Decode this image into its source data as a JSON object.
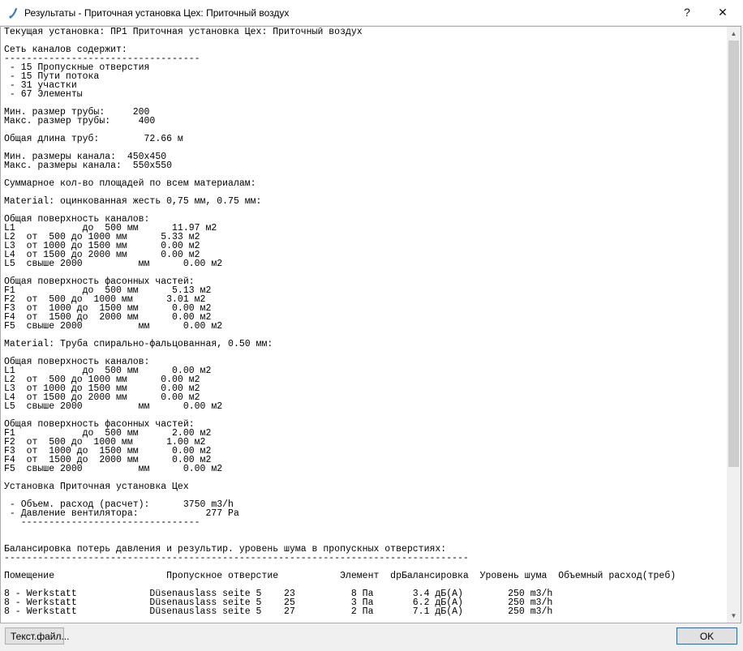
{
  "window": {
    "title": "Результаты - Приточная установка Цех: Приточный воздух",
    "help_label": "?",
    "close_label": "✕"
  },
  "report": {
    "text": "Текущая установка: ПР1 Приточная установка Цех: Приточный воздух\n\nСеть каналов содержит:\n-----------------------------------\n - 15 Пропускные отверстия\n - 15 Пути потока\n - 31 участки\n - 67 Элементы\n\nМин. размер трубы:     200\nМакс. размер трубы:     400\n\nОбщая длина труб:        72.66 м\n\nМин. размеры канала:  450x450\nМакс. размеры канала:  550x550\n\nСуммарное кол-во площадей по всем материалам:\n\nMaterial: оцинкованная жесть 0,75 мм, 0.75 мм:\n\nОбщая поверхность каналов:\nL1            до  500 мм      11.97 м2\nL2  от  500 до 1000 мм      5.33 м2\nL3  от 1000 до 1500 мм      0.00 м2\nL4  от 1500 до 2000 мм      0.00 м2\nL5  свыше 2000          мм      0.00 м2\n\nОбщая поверхность фасонных частей:\nF1            до  500 мм      5.13 м2\nF2  от  500 до  1000 мм      3.01 м2\nF3  от  1000 до  1500 мм      0.00 м2\nF4  от  1500 до  2000 мм      0.00 м2\nF5  свыше 2000          мм      0.00 м2\n\nMaterial: Труба спирально-фальцованная, 0.50 мм:\n\nОбщая поверхность каналов:\nL1            до  500 мм      0.00 м2\nL2  от  500 до 1000 мм      0.00 м2\nL3  от 1000 до 1500 мм      0.00 м2\nL4  от 1500 до 2000 мм      0.00 м2\nL5  свыше 2000          мм      0.00 м2\n\nОбщая поверхность фасонных частей:\nF1            до  500 мм      2.00 м2\nF2  от  500 до  1000 мм      1.00 м2\nF3  от  1000 до  1500 мм      0.00 м2\nF4  от  1500 до  2000 мм      0.00 м2\nF5  свыше 2000          мм      0.00 м2\n\nУстановка Приточная установка Цех\n\n - Объем. расход (расчет):      3750 m3/h\n - Давление вентилятора:            277 Pa\n   --------------------------------\n\n\nБалансировка потерь давления и результир. уровень шума в пропускных отверстиях:\n-----------------------------------------------------------------------------------\n\nПомещение                    Пропускное отверстие           Элемент  dpБалансировка  Уровень шума  Объемный расход(треб)\n\n8 - Werkstatt             Düsenauslass seite 5    23          8 Па       3.4 дБ(A)        250 m3/h\n8 - Werkstatt             Düsenauslass seite 5    25          3 Па       6.2 дБ(A)        250 m3/h\n8 - Werkstatt             Düsenauslass seite 5    27          2 Па       7.1 дБ(A)        250 m3/h"
  },
  "buttons": {
    "text_file": "Текст.файл...",
    "ok": "OK"
  },
  "scrollbar": {
    "up_arrow": "▲",
    "down_arrow": "▼"
  },
  "colors": {
    "accent": "#0078d7",
    "icon": "#3a7abf"
  }
}
